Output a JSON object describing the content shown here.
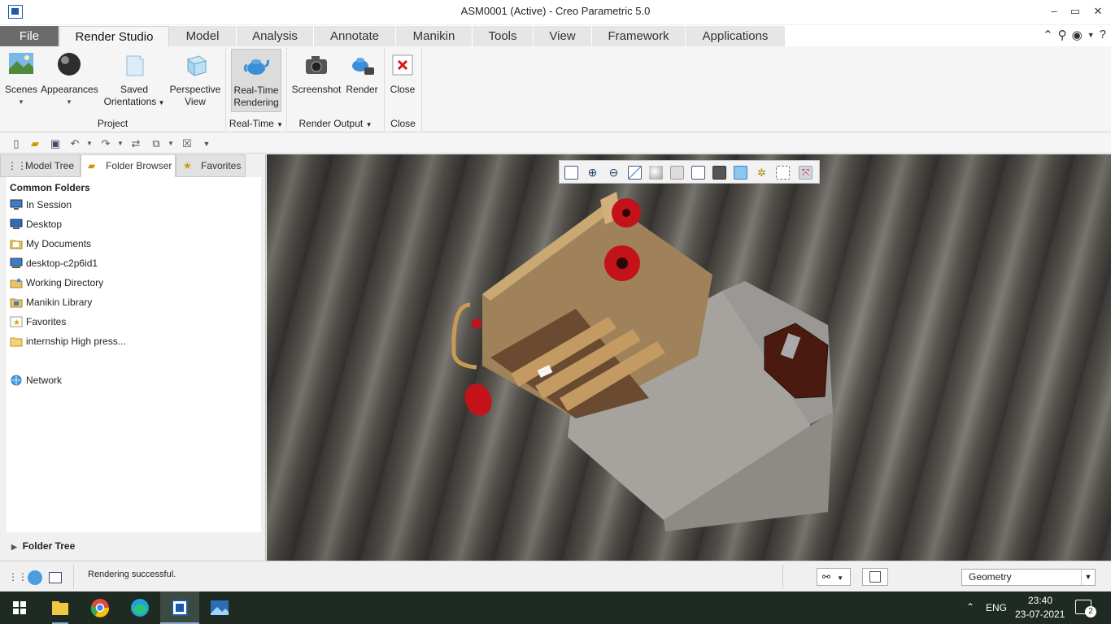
{
  "window": {
    "title": "ASM0001 (Active) - Creo Parametric 5.0",
    "controls": [
      "–",
      "▭",
      "✕"
    ]
  },
  "tabs": [
    {
      "label": "File"
    },
    {
      "label": "Render Studio"
    },
    {
      "label": "Model"
    },
    {
      "label": "Analysis"
    },
    {
      "label": "Annotate"
    },
    {
      "label": "Manikin"
    },
    {
      "label": "Tools"
    },
    {
      "label": "View"
    },
    {
      "label": "Framework"
    },
    {
      "label": "Applications"
    }
  ],
  "ribbon": {
    "buttons": {
      "scenes": "Scenes",
      "appearances": "Appearances",
      "saved_line1": "Saved",
      "saved_line2": "Orientations",
      "perspective_line1": "Perspective",
      "perspective_line2": "View",
      "rt_line1": "Real-Time",
      "rt_line2": "Rendering",
      "screenshot": "Screenshot",
      "render": "Render",
      "close": "Close"
    },
    "groups": {
      "project": "Project",
      "realtime": "Real-Time",
      "render_output": "Render Output",
      "close": "Close"
    }
  },
  "left_panel": {
    "tabs": {
      "model_tree": "Model Tree",
      "folder_browser": "Folder Browser",
      "favorites": "Favorites"
    },
    "common_folders": "Common Folders",
    "items": [
      {
        "label": "In Session",
        "icon": "monitor-icon"
      },
      {
        "label": "Desktop",
        "icon": "desktop-icon"
      },
      {
        "label": "My Documents",
        "icon": "documents-icon"
      },
      {
        "label": "desktop-c2p6id1",
        "icon": "computer-icon"
      },
      {
        "label": "Working Directory",
        "icon": "working-folder-icon"
      },
      {
        "label": "Manikin Library",
        "icon": "library-folder-icon"
      },
      {
        "label": "Favorites",
        "icon": "favorites-folder-icon"
      },
      {
        "label": "internship High press...",
        "icon": "folder-icon"
      },
      {
        "label": "Network",
        "icon": "network-icon"
      }
    ],
    "folder_tree": "Folder Tree"
  },
  "status": {
    "message": "Rendering successful.",
    "filter_value": "Geometry"
  },
  "taskbar": {
    "language": "ENG",
    "time": "23:40",
    "date": "23-07-2021",
    "notifications": "2"
  }
}
